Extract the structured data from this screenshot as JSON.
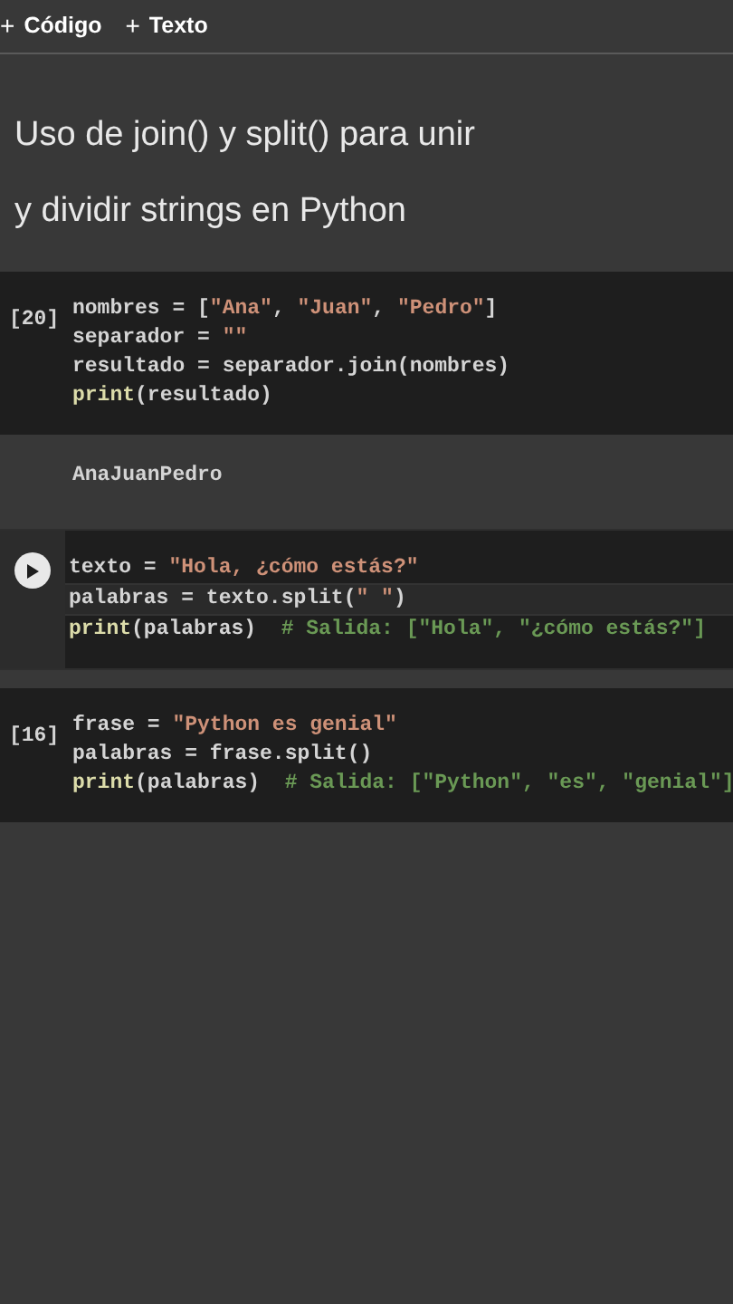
{
  "toolbar": {
    "buttons": [
      {
        "icon": "+",
        "label": "Código"
      },
      {
        "icon": "+",
        "label": "Texto"
      }
    ]
  },
  "title_lines": [
    "Uso de join() y split() para unir",
    "y dividir strings en Python"
  ],
  "cells": [
    {
      "exec_count": "[20]",
      "active": false,
      "lines": [
        {
          "current": false,
          "tokens": [
            {
              "kind": "plain",
              "text": "nombres = ["
            },
            {
              "kind": "string",
              "text": "\"Ana\""
            },
            {
              "kind": "plain",
              "text": ", "
            },
            {
              "kind": "string",
              "text": "\"Juan\""
            },
            {
              "kind": "plain",
              "text": ", "
            },
            {
              "kind": "string",
              "text": "\"Pedro\""
            },
            {
              "kind": "plain",
              "text": "]"
            }
          ]
        },
        {
          "current": false,
          "tokens": [
            {
              "kind": "plain",
              "text": "separador = "
            },
            {
              "kind": "string",
              "text": "\"\""
            }
          ]
        },
        {
          "current": false,
          "tokens": [
            {
              "kind": "plain",
              "text": "resultado = separador.join(nombres)"
            }
          ]
        },
        {
          "current": false,
          "tokens": [
            {
              "kind": "func",
              "text": "print"
            },
            {
              "kind": "plain",
              "text": "(resultado)"
            }
          ]
        }
      ],
      "output": "AnaJuanPedro"
    },
    {
      "active": true,
      "lines": [
        {
          "current": false,
          "tokens": [
            {
              "kind": "plain",
              "text": "texto = "
            },
            {
              "kind": "string",
              "text": "\"Hola, ¿cómo estás?\""
            }
          ]
        },
        {
          "current": true,
          "tokens": [
            {
              "kind": "plain",
              "text": "palabras = texto.split("
            },
            {
              "kind": "string",
              "text": "\" \""
            },
            {
              "kind": "plain",
              "text": ")"
            }
          ]
        },
        {
          "current": false,
          "tokens": [
            {
              "kind": "func",
              "text": "print"
            },
            {
              "kind": "plain",
              "text": "(palabras)  "
            },
            {
              "kind": "comment",
              "text": "# Salida: [\"Hola\", \"¿cómo estás?\"]"
            }
          ]
        }
      ]
    },
    {
      "exec_count": "[16]",
      "active": false,
      "lines": [
        {
          "current": false,
          "tokens": [
            {
              "kind": "plain",
              "text": "frase = "
            },
            {
              "kind": "string",
              "text": "\"Python es genial\""
            }
          ]
        },
        {
          "current": false,
          "tokens": [
            {
              "kind": "plain",
              "text": "palabras = frase.split()"
            }
          ]
        },
        {
          "current": false,
          "tokens": [
            {
              "kind": "func",
              "text": "print"
            },
            {
              "kind": "plain",
              "text": "(palabras)  "
            },
            {
              "kind": "comment",
              "text": "# Salida: [\"Python\", \"es\", \"genial\"]"
            }
          ]
        }
      ]
    }
  ]
}
